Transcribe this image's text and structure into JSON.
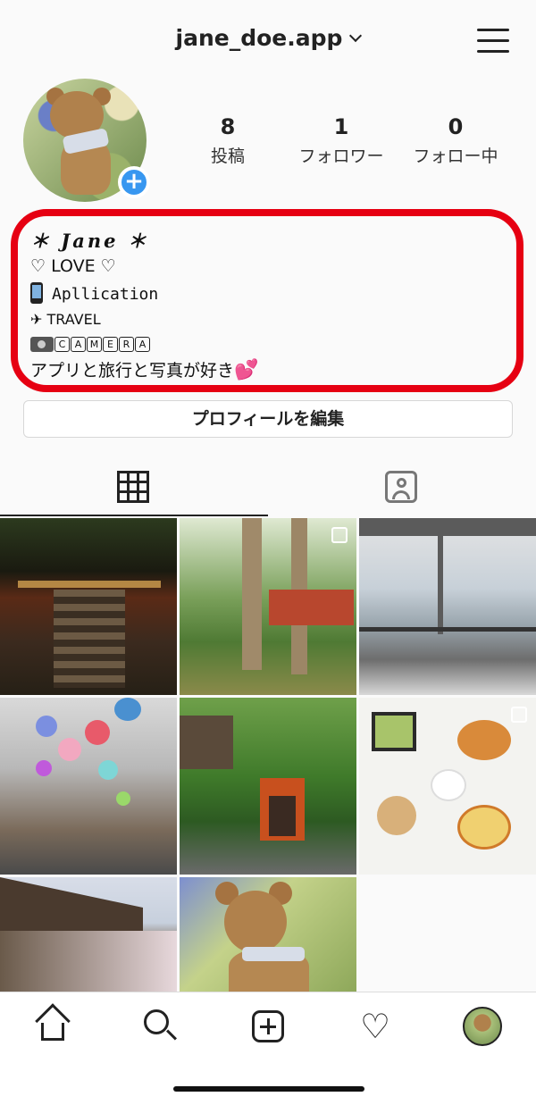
{
  "header": {
    "username": "jane_doe.app"
  },
  "stats": [
    {
      "count": "8",
      "label": "投稿"
    },
    {
      "count": "1",
      "label": "フォロワー"
    },
    {
      "count": "0",
      "label": "フォロー中"
    }
  ],
  "bio": {
    "name": "＊ Jane ＊",
    "love": "♡ LOVE ♡",
    "application": "Apllication",
    "travel": "✈ TRAVEL",
    "camera_letters": [
      "C",
      "A",
      "M",
      "E",
      "R",
      "A"
    ],
    "description": "アプリと旅行と写真が好き",
    "heart": "💕"
  },
  "edit_profile_label": "プロフィールを編集",
  "colors": {
    "highlight_border": "#e60012",
    "accent": "#3897f0"
  },
  "icons": [
    "grid-icon",
    "tagged-icon",
    "home-icon",
    "search-icon",
    "add-post-icon",
    "heart-icon",
    "profile-icon"
  ]
}
